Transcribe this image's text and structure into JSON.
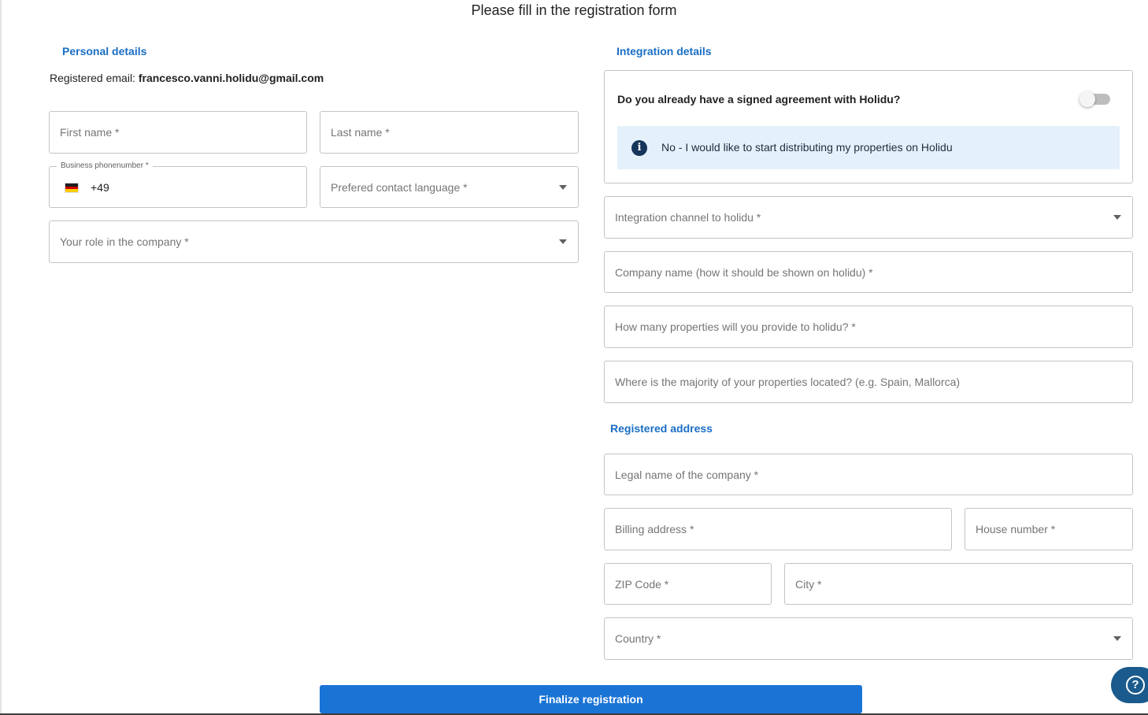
{
  "page": {
    "title": "Please fill in the registration form"
  },
  "personal": {
    "section_title": "Personal details",
    "email_label": "Registered email: ",
    "email_value": "francesco.vanni.holidu@gmail.com",
    "first_name_placeholder": "First name *",
    "last_name_placeholder": "Last name *",
    "phone_label": "Business phonenumber *",
    "phone_value": "+49",
    "phone_country": "Germany",
    "contact_language_placeholder": "Prefered contact language *",
    "role_placeholder": "Your role in the company *"
  },
  "integration": {
    "section_title": "Integration details",
    "agreement_question": "Do you already have a signed agreement with Holidu?",
    "agreement_toggle_on": false,
    "agreement_info": "No - I would like to start distributing my properties on Holidu",
    "channel_placeholder": "Integration channel to holidu *",
    "company_name_placeholder": "Company name (how it should be shown on holidu) *",
    "properties_count_placeholder": "How many properties will you provide to holidu? *",
    "properties_location_placeholder": "Where is the majority of your properties located? (e.g. Spain, Mallorca)"
  },
  "address": {
    "section_title": "Registered address",
    "legal_name_placeholder": "Legal name of the company *",
    "billing_address_placeholder": "Billing address *",
    "house_number_placeholder": "House number *",
    "zip_placeholder": "ZIP Code *",
    "city_placeholder": "City *",
    "country_placeholder": "Country *"
  },
  "actions": {
    "submit_label": "Finalize registration"
  },
  "colors": {
    "accent": "#1a74d6",
    "section_title": "#1a6ec5",
    "info_bg": "#e4f1fb",
    "help_fab": "#1a5a8c"
  },
  "icons": [
    "germany-flag-icon",
    "chevron-down-icon",
    "info-icon",
    "help-icon"
  ]
}
